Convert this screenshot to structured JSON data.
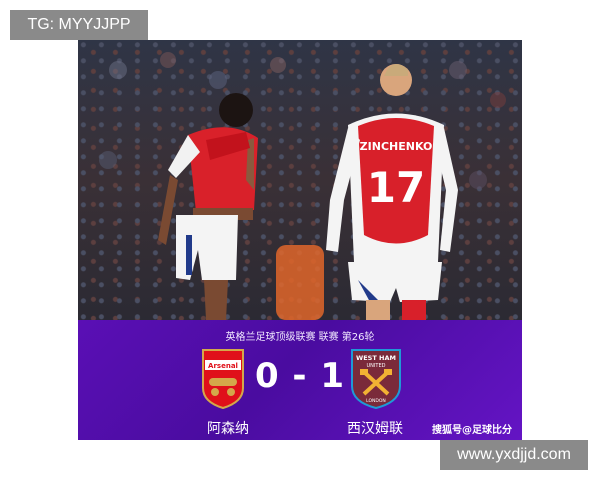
{
  "watermarks": {
    "top_left": "TG: MYYJJPP",
    "bottom_right": "www.yxdjjd.com"
  },
  "photo": {
    "player_right_name": "ZINCHENKO",
    "player_right_number": "17"
  },
  "match": {
    "league_line": "英格兰足球顶级联赛 联赛 第26轮",
    "score": "0 - 1",
    "home": {
      "name": "阿森纳",
      "crest_text": "Arsenal",
      "color": "#e0101a"
    },
    "away": {
      "name": "西汉姆联",
      "crest_text_1": "WEST HAM",
      "crest_text_2": "UNITED",
      "crest_text_3": "LONDON",
      "color": "#7a2a3a"
    }
  },
  "source_label": "搜狐号@足球比分",
  "colors": {
    "banner": "#5a0fb5",
    "watermark_bg": "#8a8a8a"
  }
}
